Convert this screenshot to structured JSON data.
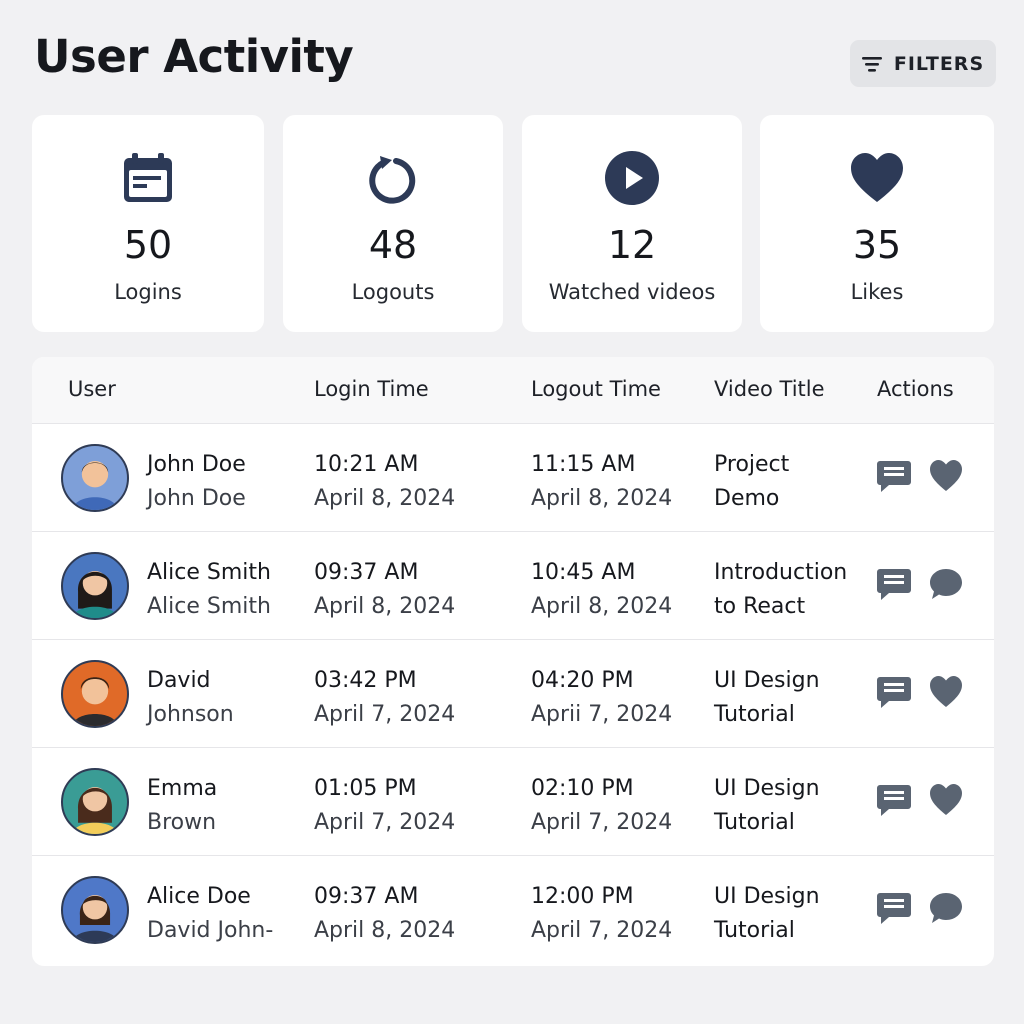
{
  "header": {
    "title": "User Activity",
    "filters_label": "FILTERS"
  },
  "stats": [
    {
      "icon": "calendar-icon",
      "value": "50",
      "label": "Logins"
    },
    {
      "icon": "refresh-icon",
      "value": "48",
      "label": "Logouts"
    },
    {
      "icon": "play-icon",
      "value": "12",
      "label": "Watched videos"
    },
    {
      "icon": "heart-icon",
      "value": "35",
      "label": "Likes"
    }
  ],
  "table": {
    "columns": [
      "User",
      "Login Time",
      "Logout Time",
      "Video Title",
      "Actions"
    ],
    "rows": [
      {
        "name": "John Doe",
        "sub": "John Doe",
        "login_time": "10:21 AM",
        "login_date": "April 8, 2024",
        "logout_time": "11:15 AM",
        "logout_date": "April 8, 2024",
        "video": [
          "Project",
          "Demo"
        ],
        "actions": [
          "comment-icon",
          "heart-icon"
        ]
      },
      {
        "name": "Alice Smith",
        "sub": "Alice Smith",
        "login_time": "09:37 AM",
        "login_date": "April 8, 2024",
        "logout_time": "10:45 AM",
        "logout_date": "April 8, 2024",
        "video": [
          "Introduction",
          "to React"
        ],
        "actions": [
          "comment-icon",
          "chat-bubble-icon"
        ]
      },
      {
        "name": "David",
        "sub": "Johnson",
        "login_time": "03:42 PM",
        "login_date": "April 7, 2024",
        "logout_time": "04:20 PM",
        "logout_date": "Aprii 7, 2024",
        "video": [
          "UI Design",
          "Tutorial"
        ],
        "actions": [
          "comment-icon",
          "heart-icon"
        ]
      },
      {
        "name": "Emma",
        "sub": "Brown",
        "login_time": "01:05 PM",
        "login_date": "April 7, 2024",
        "logout_time": "02:10 PM",
        "logout_date": "April 7, 2024",
        "video": [
          "UI Design",
          "Tutorial"
        ],
        "actions": [
          "comment-icon",
          "heart-icon"
        ]
      },
      {
        "name": "Alice Doe",
        "sub": "David John-",
        "login_time": "09:37 AM",
        "login_date": "April 8, 2024",
        "logout_time": "12:00 PM",
        "logout_date": "April 7, 2024",
        "video": [
          "UI Design",
          "Tutorial"
        ],
        "actions": [
          "comment-icon",
          "chat-bubble-icon"
        ]
      }
    ]
  },
  "colors": {
    "icon_dark": "#2d3a57",
    "action_icon": "#5a6472",
    "avatars": [
      "#7e9fd8",
      "#4a77c0",
      "#e06a28",
      "#3a9c95",
      "#4f78c8"
    ]
  }
}
